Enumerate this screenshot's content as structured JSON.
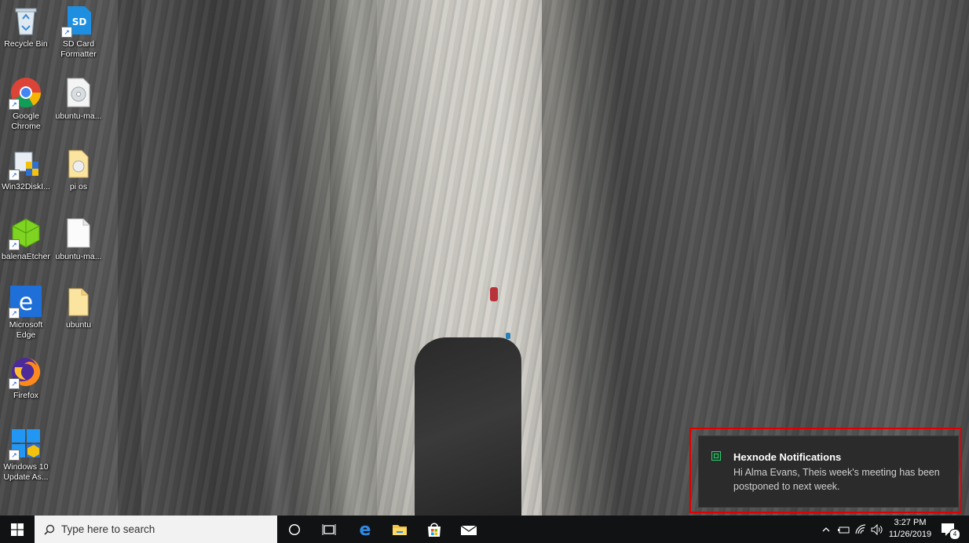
{
  "desktop": {
    "icons": [
      {
        "label": "Recycle Bin",
        "icon": "recycle-bin-icon"
      },
      {
        "label": "SD Card Formatter",
        "icon": "sd-card-icon"
      },
      {
        "label": "Google Chrome",
        "icon": "chrome-icon"
      },
      {
        "label": "ubuntu-ma...",
        "icon": "disc-image-icon"
      },
      {
        "label": "Win32DiskI...",
        "icon": "win32-disk-imager-icon"
      },
      {
        "label": "pi os",
        "icon": "folder-icon"
      },
      {
        "label": "balenaEtcher",
        "icon": "balena-etcher-icon"
      },
      {
        "label": "ubuntu-ma...",
        "icon": "document-icon"
      },
      {
        "label": "Microsoft Edge",
        "icon": "edge-icon"
      },
      {
        "label": "ubuntu",
        "icon": "folder-icon"
      },
      {
        "label": "Firefox",
        "icon": "firefox-icon"
      },
      {
        "label": "Windows 10 Update As...",
        "icon": "windows-update-icon"
      }
    ]
  },
  "notification": {
    "app": "Hexnode Notifications",
    "message": "Hi Alma Evans, Theis week's meeting has been postponed to next week.",
    "highlight_color": "#e00000"
  },
  "taskbar": {
    "search_placeholder": "Type here to search",
    "pinned": [
      "cortana-icon",
      "task-view-icon",
      "edge-icon",
      "file-explorer-icon",
      "store-icon",
      "mail-icon"
    ],
    "clock_time": "3:27 PM",
    "clock_date": "11/26/2019",
    "notification_count": "4"
  },
  "colors": {
    "taskbar_bg": "#101214",
    "toast_bg": "#2b2b2b",
    "accent_green": "#2ecf6a"
  }
}
